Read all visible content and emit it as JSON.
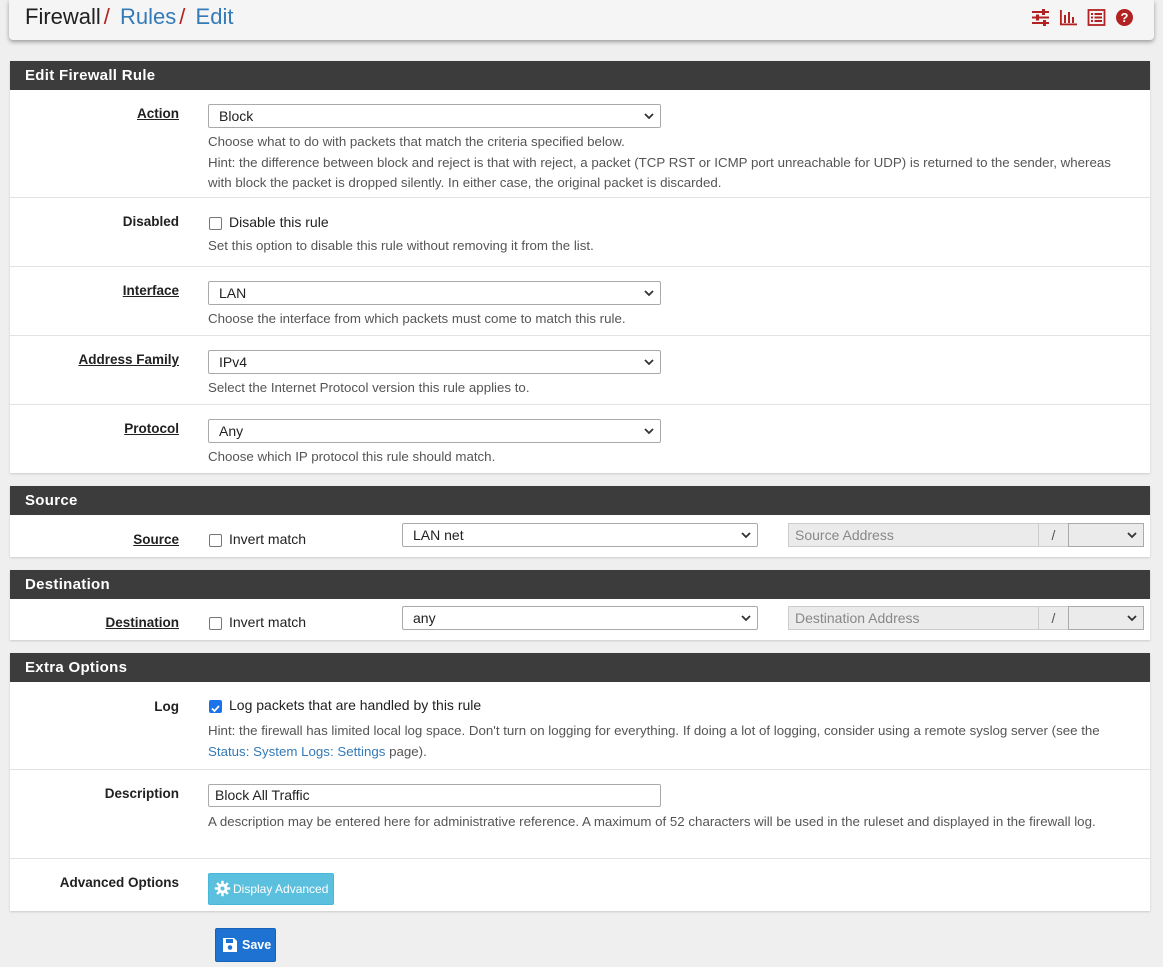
{
  "breadcrumb": {
    "root": "Firewall",
    "level1": "Rules",
    "level2": "Edit",
    "separator": "/"
  },
  "header_icons": [
    "sliders-icon",
    "bar-chart-icon",
    "list-icon",
    "help-icon"
  ],
  "edit_rule": {
    "heading": "Edit Firewall Rule",
    "action": {
      "label": "Action",
      "value": "Block",
      "help1": "Choose what to do with packets that match the criteria specified below.",
      "help2": "Hint: the difference between block and reject is that with reject, a packet (TCP RST or ICMP port unreachable for UDP) is returned to the sender, whereas with block the packet is dropped silently. In either case, the original packet is discarded."
    },
    "disabled": {
      "label": "Disabled",
      "checkbox_label": "Disable this rule",
      "checked": false,
      "help": "Set this option to disable this rule without removing it from the list."
    },
    "interface": {
      "label": "Interface",
      "value": "LAN",
      "help": "Choose the interface from which packets must come to match this rule."
    },
    "address_family": {
      "label": "Address Family",
      "value": "IPv4",
      "help": "Select the Internet Protocol version this rule applies to."
    },
    "protocol": {
      "label": "Protocol",
      "value": "Any",
      "help": "Choose which IP protocol this rule should match."
    }
  },
  "source": {
    "heading": "Source",
    "label": "Source",
    "invert_label": "Invert match",
    "invert_checked": false,
    "type_value": "LAN net",
    "address_placeholder": "Source Address",
    "slash": "/"
  },
  "destination": {
    "heading": "Destination",
    "label": "Destination",
    "invert_label": "Invert match",
    "invert_checked": false,
    "type_value": "any",
    "address_placeholder": "Destination Address",
    "slash": "/"
  },
  "extra": {
    "heading": "Extra Options",
    "log": {
      "label": "Log",
      "checkbox_label": "Log packets that are handled by this rule",
      "checked": true,
      "help_pre": "Hint: the firewall has limited local log space. Don't turn on logging for everything. If doing a lot of logging, consider using a remote syslog server (see the ",
      "help_link": "Status: System Logs: Settings",
      "help_post": " page)."
    },
    "description": {
      "label": "Description",
      "value": "Block All Traffic",
      "help": "A description may be entered here for administrative reference. A maximum of 52 characters will be used in the ruleset and displayed in the firewall log."
    },
    "advanced": {
      "label": "Advanced Options",
      "button": "Display Advanced"
    }
  },
  "save_button": "Save",
  "colors": {
    "header_bg": "#3c3c3c",
    "link": "#337ab7",
    "accent_red": "#b22222",
    "info_button": "#5bc0de",
    "primary_button": "#1e73d2"
  }
}
